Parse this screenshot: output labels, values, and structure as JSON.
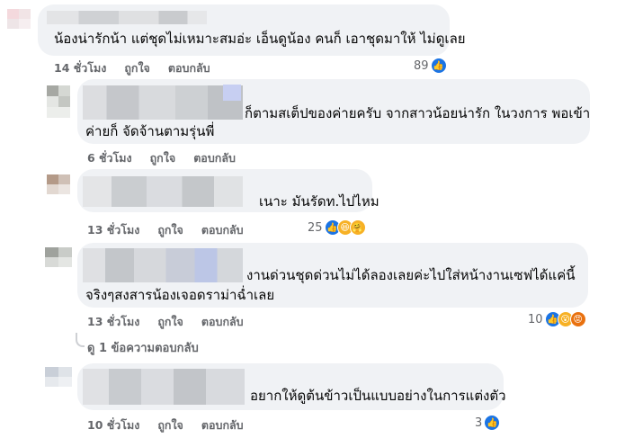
{
  "comments": [
    {
      "text": "น้องน่ารักน้า แต่ชุดไม่เหมาะสมอ่ะ เอ็นดูน้อง คนก็ เอาชุดมาให้ ไม่ดูเลย",
      "time": "14 ชั่วโมง",
      "like_label": "ถูกใจ",
      "reply_label": "ตอบกลับ",
      "reaction_count": "89",
      "reactions": [
        "like-icon"
      ]
    },
    {
      "text_line1": "ก็ตามสเต็ปของค่ายครับ จากสาวน้อยน่ารัก ในวงการ พอเข้า",
      "text_line2": "ค่ายก็ จัดจ้านตามรุ่นพี่",
      "time": "6 ชั่วโมง",
      "like_label": "ถูกใจ",
      "reply_label": "ตอบกลับ"
    },
    {
      "text": "เนาะ มันรัดท.ไปไหม",
      "time": "13 ชั่วโมง",
      "like_label": "ถูกใจ",
      "reply_label": "ตอบกลับ",
      "reaction_count": "25",
      "reactions": [
        "like-icon",
        "haha-icon",
        "care-icon"
      ]
    },
    {
      "text_line1": "งานด่วนชุดด่วนไม่ได้ลองเลยค่ะไปใส่หน้างานเซฟได้แค่นี้",
      "text_line2": "จริงๆสงสารน้องเจอดราม่าฉ่ำเลย",
      "time": "13 ชั่วโมง",
      "like_label": "ถูกใจ",
      "reply_label": "ตอบกลับ",
      "reaction_count": "10",
      "reactions": [
        "like-icon",
        "wow-icon",
        "angry-icon"
      ]
    },
    {
      "view_replies": "ดู 1 ข้อความตอบกลับ"
    },
    {
      "text": "อยากให้ดูต้นข้าวเป็นแบบอย่างในการแต่งตัว",
      "time": "10 ชั่วโมง",
      "like_label": "ถูกใจ",
      "reply_label": "ตอบกลับ",
      "reaction_count": "3",
      "reactions": [
        "like-icon"
      ]
    }
  ],
  "colors": {
    "bubble": "#f0f2f5",
    "meta": "#65676b",
    "like": "#1b74e4"
  }
}
